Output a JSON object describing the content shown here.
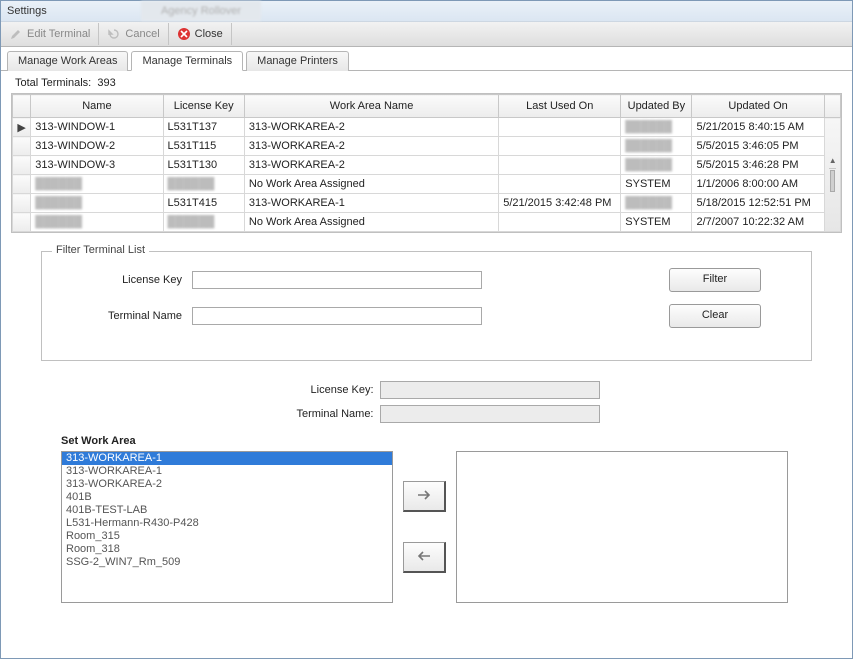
{
  "window": {
    "title": "Settings",
    "ghost_tab": "Agency Rollover"
  },
  "toolbar": {
    "edit_label": "Edit Terminal",
    "cancel_label": "Cancel",
    "close_label": "Close"
  },
  "tabs": {
    "work_areas": "Manage Work Areas",
    "terminals": "Manage Terminals",
    "printers": "Manage Printers"
  },
  "total": {
    "prefix": "Total Terminals:",
    "count": "393"
  },
  "grid": {
    "headers": {
      "name": "Name",
      "license": "License Key",
      "workarea": "Work Area Name",
      "lastused": "Last Used On",
      "updatedby": "Updated By",
      "updatedon": "Updated On"
    },
    "rows": [
      {
        "marker": "▶",
        "name": "313-WINDOW-1",
        "license": "L531T137",
        "workarea": "313-WORKAREA-2",
        "lastused": "",
        "updatedby": "blurred",
        "updatedon": "5/21/2015 8:40:15 AM"
      },
      {
        "marker": "",
        "name": "313-WINDOW-2",
        "license": "L531T115",
        "workarea": "313-WORKAREA-2",
        "lastused": "",
        "updatedby": "blurred",
        "updatedon": "5/5/2015 3:46:05 PM"
      },
      {
        "marker": "",
        "name": "313-WINDOW-3",
        "license": "L531T130",
        "workarea": "313-WORKAREA-2",
        "lastused": "",
        "updatedby": "blurred",
        "updatedon": "5/5/2015 3:46:28 PM"
      },
      {
        "marker": "",
        "name": "blurred",
        "license": "blurred",
        "workarea": "No Work Area Assigned",
        "lastused": "",
        "updatedby": "SYSTEM",
        "updatedon": "1/1/2006 8:00:00 AM"
      },
      {
        "marker": "",
        "name": "blurred",
        "license": "L531T415",
        "workarea": "313-WORKAREA-1",
        "lastused": "5/21/2015 3:42:48 PM",
        "updatedby": "blurred",
        "updatedon": "5/18/2015 12:52:51 PM"
      },
      {
        "marker": "",
        "name": "blurred",
        "license": "blurred",
        "workarea": "No Work Area Assigned",
        "lastused": "",
        "updatedby": "SYSTEM",
        "updatedon": "2/7/2007 10:22:32 AM"
      }
    ]
  },
  "filter": {
    "legend": "Filter Terminal List",
    "license_label": "License Key",
    "terminal_label": "Terminal Name",
    "filter_btn": "Filter",
    "clear_btn": "Clear"
  },
  "detail": {
    "license_label": "License Key:",
    "terminal_label": "Terminal Name:"
  },
  "set_area": {
    "label": "Set Work Area",
    "items": [
      "313-WORKAREA-1",
      "313-WORKAREA-1",
      "313-WORKAREA-2",
      "401B",
      "401B-TEST-LAB",
      "L531-Hermann-R430-P428",
      "Room_315",
      "Room_318",
      "SSG-2_WIN7_Rm_509"
    ]
  }
}
